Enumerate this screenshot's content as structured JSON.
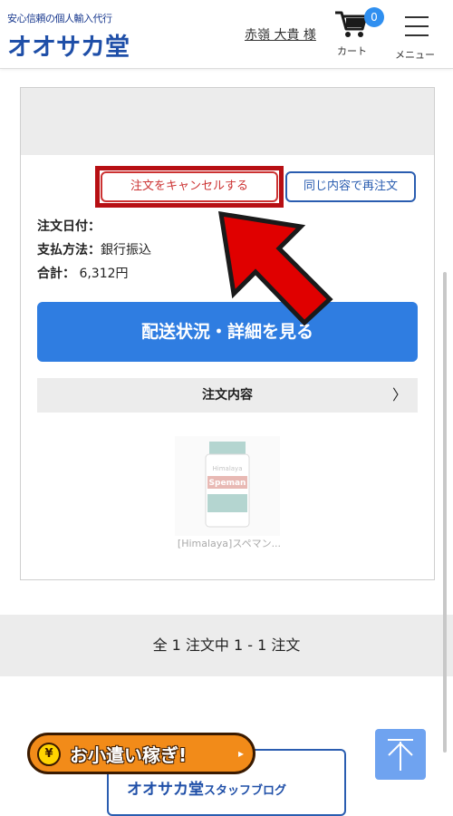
{
  "header": {
    "tagline": "安心信頼の個人輸入代行",
    "logo": "オオサカ堂",
    "user_name": "赤嶺 大貴 様",
    "cart_count": "0",
    "cart_label": "カート",
    "menu_label": "メニュー"
  },
  "order": {
    "cancel_label": "注文をキャンセルする",
    "reorder_label": "同じ内容で再注文",
    "date_label": "注文日付：",
    "date_value": "",
    "payment_label": "支払方法：",
    "payment_value": "銀行振込",
    "total_label": "合計：",
    "total_value": " 6,312円",
    "detail_button": "配送状況・詳細を見る",
    "contents_label": "注文内容",
    "contents_chevron": "〉",
    "product_name": "[Himalaya]スペマン...",
    "product_image_text": "Speman",
    "product_brand_text": "Himalaya"
  },
  "pager": {
    "text": "全 1 注文中 1 - 1 注文"
  },
  "footer": {
    "okozukai_icon": "¥",
    "okozukai_label": "お小遣い稼ぎ!",
    "okozukai_arrow": "▸",
    "blog_logo": "オオサカ堂",
    "blog_label": "スタッフブログ"
  },
  "colors": {
    "accent": "#2f7de1",
    "cancel": "#cc3333",
    "highlight": "#b70f13",
    "arrow": "#e00000"
  }
}
